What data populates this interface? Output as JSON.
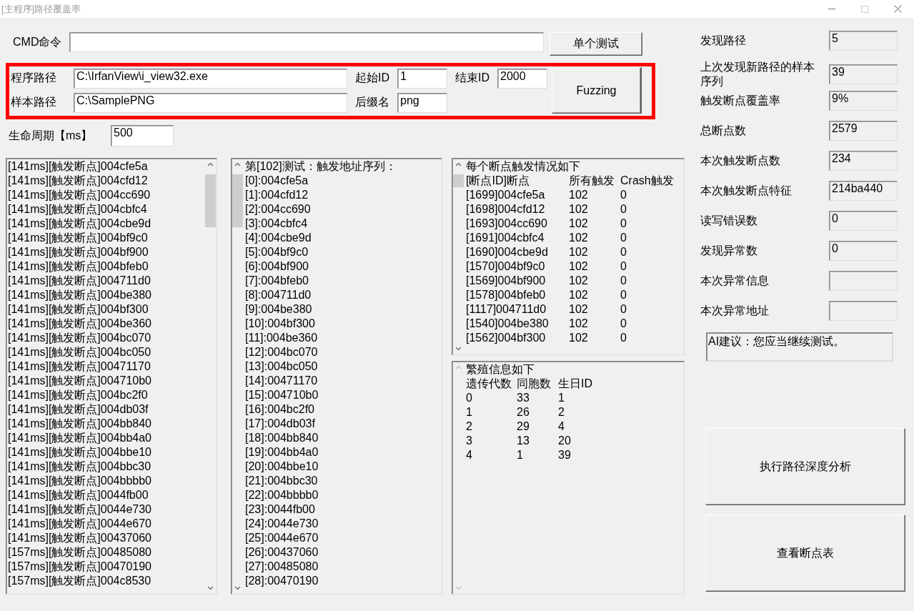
{
  "window": {
    "title": "[主程序]路径覆盖率"
  },
  "cmd": {
    "label": "CMD命令",
    "button": "单个测试"
  },
  "config": {
    "program_label": "程序路径",
    "program_path": "C:\\IrfanView\\i_view32.exe",
    "start_label": "起始ID",
    "start_id": "1",
    "end_label": "结束ID",
    "end_id": "2000",
    "sample_label": "样本路径",
    "sample_path": "C:\\SamplePNG",
    "suffix_label": "后缀名",
    "suffix": "png",
    "fuzz_button": "Fuzzing"
  },
  "lifetime": {
    "label": "生命周期【ms】",
    "value": "500"
  },
  "log_list": {
    "items": [
      "[141ms][触发断点]004cfe5a",
      "[141ms][触发断点]004cfd12",
      "[141ms][触发断点]004cc690",
      "[141ms][触发断点]004cbfc4",
      "[141ms][触发断点]004cbe9d",
      "[141ms][触发断点]004bf9c0",
      "[141ms][触发断点]004bf900",
      "[141ms][触发断点]004bfeb0",
      "[141ms][触发断点]004711d0",
      "[141ms][触发断点]004be380",
      "[141ms][触发断点]004bf300",
      "[141ms][触发断点]004be360",
      "[141ms][触发断点]004bc070",
      "[141ms][触发断点]004bc050",
      "[141ms][触发断点]00471170",
      "[141ms][触发断点]004710b0",
      "[141ms][触发断点]004bc2f0",
      "[141ms][触发断点]004db03f",
      "[141ms][触发断点]004bb840",
      "[141ms][触发断点]004bb4a0",
      "[141ms][触发断点]004bbe10",
      "[141ms][触发断点]004bbc30",
      "[141ms][触发断点]004bbbb0",
      "[141ms][触发断点]0044fb00",
      "[141ms][触发断点]0044e730",
      "[141ms][触发断点]0044e670",
      "[141ms][触发断点]00437060",
      "[157ms][触发断点]00485080",
      "[157ms][触发断点]00470190",
      "[157ms][触发断点]004c8530"
    ]
  },
  "sequence_list": {
    "header": "第[102]测试：触发地址序列：",
    "items": [
      "[0]:004cfe5a",
      "[1]:004cfd12",
      "[2]:004cc690",
      "[3]:004cbfc4",
      "[4]:004cbe9d",
      "[5]:004bf9c0",
      "[6]:004bf900",
      "[7]:004bfeb0",
      "[8]:004711d0",
      "[9]:004be380",
      "[10]:004bf300",
      "[11]:004be360",
      "[12]:004bc070",
      "[13]:004bc050",
      "[14]:00471170",
      "[15]:004710b0",
      "[16]:004bc2f0",
      "[17]:004db03f",
      "[18]:004bb840",
      "[19]:004bb4a0",
      "[20]:004bbe10",
      "[21]:004bbc30",
      "[22]:004bbbb0",
      "[23]:0044fb00",
      "[24]:0044e730",
      "[25]:0044e670",
      "[26]:00437060",
      "[27]:00485080",
      "[28]:00470190"
    ]
  },
  "breakpoint_table": {
    "title": "每个断点触发情况如下",
    "columns": [
      "[断点ID]断点",
      "所有触发",
      "Crash触发"
    ],
    "rows": [
      [
        "[1699]004cfe5a",
        "102",
        "0"
      ],
      [
        "[1698]004cfd12",
        "102",
        "0"
      ],
      [
        "[1693]004cc690",
        "102",
        "0"
      ],
      [
        "[1691]004cbfc4",
        "102",
        "0"
      ],
      [
        "[1690]004cbe9d",
        "102",
        "0"
      ],
      [
        "[1570]004bf9c0",
        "102",
        "0"
      ],
      [
        "[1569]004bf900",
        "102",
        "0"
      ],
      [
        "[1578]004bfeb0",
        "102",
        "0"
      ],
      [
        "[1117]004711d0",
        "102",
        "0"
      ],
      [
        "[1540]004be380",
        "102",
        "0"
      ],
      [
        "[1562]004bf300",
        "102",
        "0"
      ]
    ]
  },
  "breeding_table": {
    "title": "繁殖信息如下",
    "columns": [
      "遗传代数",
      "同胞数",
      "生日ID"
    ],
    "rows": [
      [
        "0",
        "33",
        "1"
      ],
      [
        "1",
        "26",
        "2"
      ],
      [
        "2",
        "29",
        "4"
      ],
      [
        "3",
        "13",
        "20"
      ],
      [
        "4",
        "1",
        "39"
      ]
    ]
  },
  "stats": [
    {
      "label": "发现路径",
      "value": "5"
    },
    {
      "label": "上次发现新路径的样本序列",
      "value": "39"
    },
    {
      "label": "触发断点覆盖率",
      "value": "9%"
    },
    {
      "label": "总断点数",
      "value": "2579"
    },
    {
      "label": "本次触发断点数",
      "value": "234"
    },
    {
      "label": "本次触发断点特征",
      "value": "214ba440"
    },
    {
      "label": "读写错误数",
      "value": "0"
    },
    {
      "label": "发现异常数",
      "value": "0"
    },
    {
      "label": "本次异常信息"
    },
    {
      "label": "本次异常地址"
    }
  ],
  "advice": "AI建议：您应当继续测试。",
  "buttons": [
    "执行路径深度分析",
    "查看断点表"
  ]
}
